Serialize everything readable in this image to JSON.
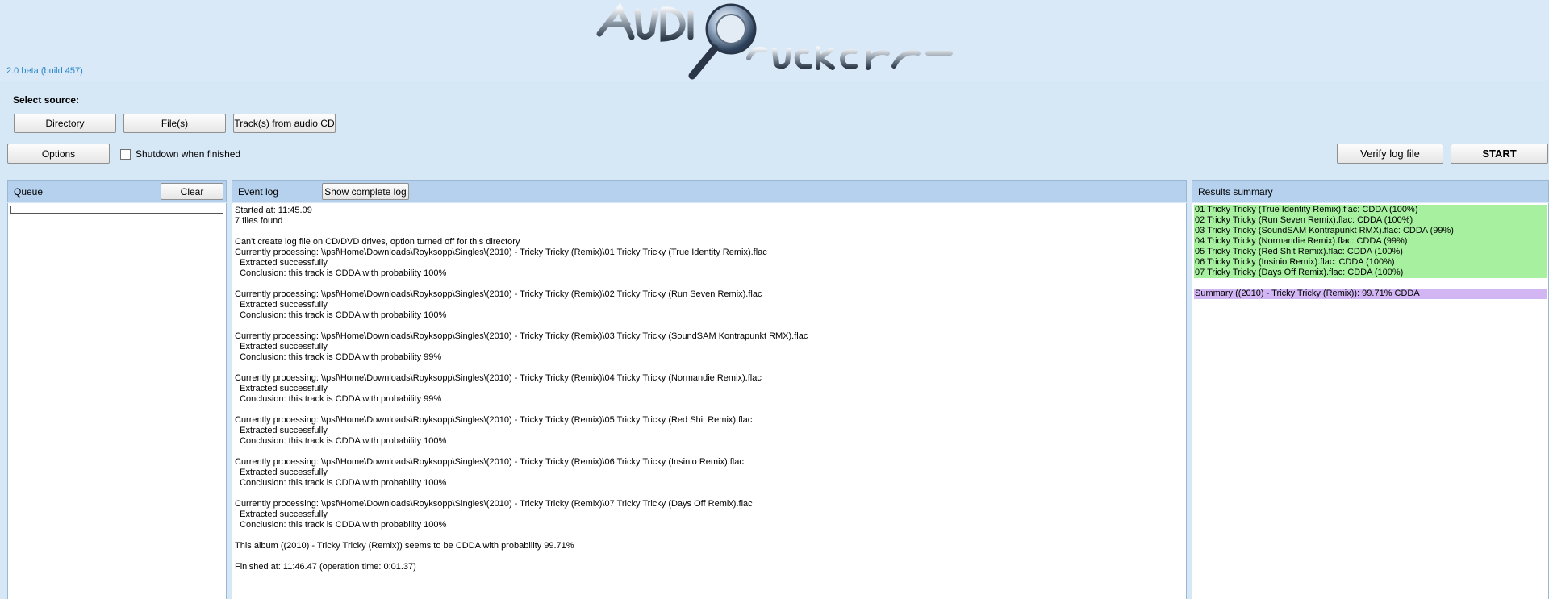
{
  "app": {
    "version": "2.0 beta (build 457)",
    "logo_alt": "Audio Checker"
  },
  "source": {
    "label": "Select source:",
    "directory_button": "Directory",
    "files_button": "File(s)",
    "audiocd_button": "Track(s) from audio CD"
  },
  "controls": {
    "options_button": "Options",
    "shutdown_label": "Shutdown when finished",
    "shutdown_checked": false,
    "verify_button": "Verify log file",
    "start_button": "START"
  },
  "queue": {
    "title": "Queue",
    "clear_button": "Clear"
  },
  "event_log": {
    "title": "Event log",
    "show_complete_button": "Show complete log",
    "lines": [
      "Started at: 11:45.09",
      "7 files found",
      "",
      "Can't create log file on CD/DVD drives, option turned off for this directory",
      "Currently processing: \\\\psf\\Home\\Downloads\\Royksopp\\Singles\\(2010) - Tricky Tricky (Remix)\\01 Tricky Tricky (True Identity Remix).flac",
      "  Extracted successfully",
      "  Conclusion: this track is CDDA with probability 100%",
      "",
      "Currently processing: \\\\psf\\Home\\Downloads\\Royksopp\\Singles\\(2010) - Tricky Tricky (Remix)\\02 Tricky Tricky (Run Seven Remix).flac",
      "  Extracted successfully",
      "  Conclusion: this track is CDDA with probability 100%",
      "",
      "Currently processing: \\\\psf\\Home\\Downloads\\Royksopp\\Singles\\(2010) - Tricky Tricky (Remix)\\03 Tricky Tricky (SoundSAM Kontrapunkt RMX).flac",
      "  Extracted successfully",
      "  Conclusion: this track is CDDA with probability 99%",
      "",
      "Currently processing: \\\\psf\\Home\\Downloads\\Royksopp\\Singles\\(2010) - Tricky Tricky (Remix)\\04 Tricky Tricky (Normandie Remix).flac",
      "  Extracted successfully",
      "  Conclusion: this track is CDDA with probability 99%",
      "",
      "Currently processing: \\\\psf\\Home\\Downloads\\Royksopp\\Singles\\(2010) - Tricky Tricky (Remix)\\05 Tricky Tricky (Red Shit Remix).flac",
      "  Extracted successfully",
      "  Conclusion: this track is CDDA with probability 100%",
      "",
      "Currently processing: \\\\psf\\Home\\Downloads\\Royksopp\\Singles\\(2010) - Tricky Tricky (Remix)\\06 Tricky Tricky (Insinio Remix).flac",
      "  Extracted successfully",
      "  Conclusion: this track is CDDA with probability 100%",
      "",
      "Currently processing: \\\\psf\\Home\\Downloads\\Royksopp\\Singles\\(2010) - Tricky Tricky (Remix)\\07 Tricky Tricky (Days Off Remix).flac",
      "  Extracted successfully",
      "  Conclusion: this track is CDDA with probability 100%",
      "",
      "This album ((2010) - Tricky Tricky (Remix)) seems to be CDDA with probability 99.71%",
      "",
      "Finished at: 11:46.47 (operation time: 0:01.37)"
    ]
  },
  "results": {
    "title": "Results summary",
    "tracks": [
      "01 Tricky Tricky (True Identity Remix).flac: CDDA (100%)",
      "02 Tricky Tricky (Run Seven Remix).flac: CDDA (100%)",
      "03 Tricky Tricky (SoundSAM Kontrapunkt RMX).flac: CDDA (99%)",
      "04 Tricky Tricky (Normandie Remix).flac: CDDA (99%)",
      "05 Tricky Tricky (Red Shit Remix).flac: CDDA (100%)",
      "06 Tricky Tricky (Insinio Remix).flac: CDDA (100%)",
      "07 Tricky Tricky (Days Off Remix).flac: CDDA (100%)"
    ],
    "summary": "Summary ((2010) - Tricky Tricky (Remix)): 99.71% CDDA"
  },
  "colors": {
    "result_ok": "#a6f0a0",
    "result_summary": "#d1b6f3",
    "panel_header": "#b5d1ee",
    "version_text": "#2a86c8"
  }
}
